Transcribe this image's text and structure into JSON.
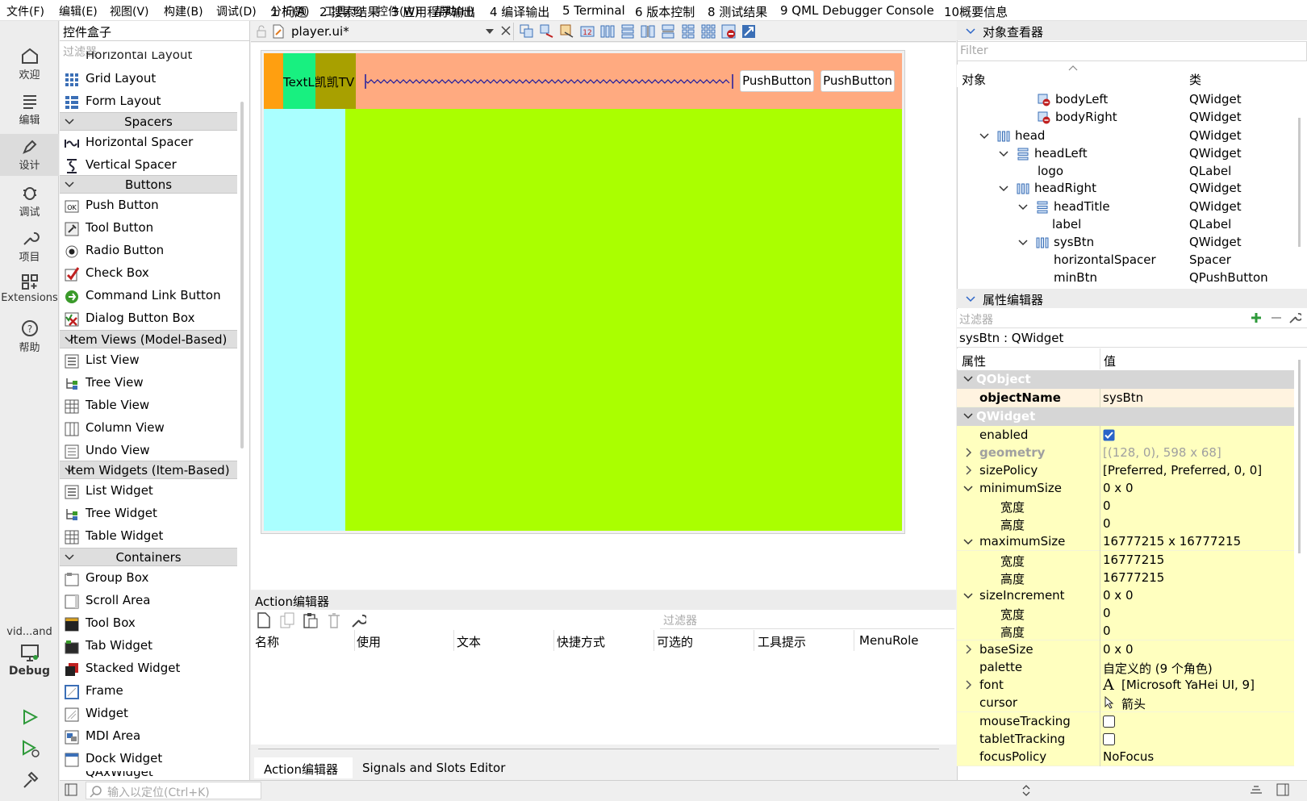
{
  "menu": [
    "文件(F)",
    "编辑(E)",
    "视图(V)",
    "构建(B)",
    "调试(D)",
    "分析(A)",
    "工具(T)",
    "控件(W)",
    "帮助(H)"
  ],
  "modes": [
    {
      "label": "欢迎",
      "icon": "home-icon"
    },
    {
      "label": "编辑",
      "icon": "edit-lines-icon"
    },
    {
      "label": "设计",
      "icon": "pen-icon"
    },
    {
      "label": "调试",
      "icon": "bug-icon"
    },
    {
      "label": "项目",
      "icon": "wrench-icon"
    },
    {
      "label": "Extensions",
      "icon": "extensions-icon"
    },
    {
      "label": "帮助",
      "icon": "help-icon"
    }
  ],
  "kit": {
    "name": "vid...and",
    "build": "Debug"
  },
  "widget_box": {
    "title": "控件盒子",
    "filter_placeholder": "过滤器",
    "clipped_item": "Horizontal Layout",
    "items_layouts": [
      "Grid Layout",
      "Form Layout"
    ],
    "cat_spacers": "Spacers",
    "items_spacers": [
      "Horizontal Spacer",
      "Vertical Spacer"
    ],
    "cat_buttons": "Buttons",
    "items_buttons": [
      "Push Button",
      "Tool Button",
      "Radio Button",
      "Check Box",
      "Command Link Button",
      "Dialog Button Box"
    ],
    "cat_item_views": "Item Views (Model-Based)",
    "items_item_views": [
      "List View",
      "Tree View",
      "Table View",
      "Column View",
      "Undo View"
    ],
    "cat_item_widgets": "Item Widgets (Item-Based)",
    "items_item_widgets": [
      "List Widget",
      "Tree Widget",
      "Table Widget"
    ],
    "cat_containers": "Containers",
    "items_containers": [
      "Group Box",
      "Scroll Area",
      "Tool Box",
      "Tab Widget",
      "Stacked Widget",
      "Frame",
      "Widget",
      "MDI Area",
      "Dock Widget",
      "QAxWidget"
    ]
  },
  "editor": {
    "file": "player.ui*",
    "form": {
      "text_label": "TextL凯凯TV",
      "btn1": "PushButton",
      "btn2": "PushButton"
    }
  },
  "action_editor": {
    "title": "Action编辑器",
    "filter_placeholder": "过滤器",
    "columns": [
      "名称",
      "使用",
      "文本",
      "快捷方式",
      "可选的",
      "工具提示",
      "MenuRole"
    ],
    "tabs": [
      "Action编辑器",
      "Signals and Slots Editor"
    ]
  },
  "object_inspector": {
    "title": "对象查看器",
    "filter_placeholder": "Filter",
    "col_object": "对象",
    "col_class": "类",
    "rows": [
      {
        "name": "bodyLeft",
        "cls": "QWidget"
      },
      {
        "name": "bodyRight",
        "cls": "QWidget"
      },
      {
        "name": "head",
        "cls": "QWidget"
      },
      {
        "name": "headLeft",
        "cls": "QWidget"
      },
      {
        "name": "logo",
        "cls": "QLabel"
      },
      {
        "name": "headRight",
        "cls": "QWidget"
      },
      {
        "name": "headTitle",
        "cls": "QWidget"
      },
      {
        "name": "label",
        "cls": "QLabel"
      },
      {
        "name": "sysBtn",
        "cls": "QWidget"
      },
      {
        "name": "horizontalSpacer",
        "cls": "Spacer"
      },
      {
        "name": "minBtn",
        "cls": "QPushButton"
      }
    ]
  },
  "property_editor": {
    "title": "属性编辑器",
    "filter_placeholder": "过滤器",
    "object_line": "sysBtn : QWidget",
    "col_prop": "属性",
    "col_value": "值",
    "group_qobject": "QObject",
    "group_qwidget": "QWidget",
    "rows": [
      {
        "name": "objectName",
        "value": "sysBtn"
      },
      {
        "name": "enabled",
        "value": ""
      },
      {
        "name": "geometry",
        "value": "[(128, 0), 598 x 68]"
      },
      {
        "name": "sizePolicy",
        "value": "[Preferred, Preferred, 0, 0]"
      },
      {
        "name": "minimumSize",
        "value": "0 x 0"
      },
      {
        "name": "宽度",
        "value": "0"
      },
      {
        "name": "高度",
        "value": "0"
      },
      {
        "name": "maximumSize",
        "value": "16777215 x 16777215"
      },
      {
        "name": "宽度",
        "value": "16777215"
      },
      {
        "name": "高度",
        "value": "16777215"
      },
      {
        "name": "sizeIncrement",
        "value": "0 x 0"
      },
      {
        "name": "宽度",
        "value": "0"
      },
      {
        "name": "高度",
        "value": "0"
      },
      {
        "name": "baseSize",
        "value": "0 x 0"
      },
      {
        "name": "palette",
        "value": "自定义的 (9 个角色)"
      },
      {
        "name": "font",
        "value": "[Microsoft YaHei UI, 9]"
      },
      {
        "name": "cursor",
        "value": "箭头"
      },
      {
        "name": "mouseTracking",
        "value": ""
      },
      {
        "name": "tabletTracking",
        "value": ""
      },
      {
        "name": "focusPolicy",
        "value": "NoFocus"
      }
    ]
  },
  "statusbar": {
    "locator_placeholder": "输入以定位(Ctrl+K)",
    "panes": [
      "1 问题",
      "2 搜索结果",
      "3 应用程序输出",
      "4 编译输出",
      "5 Terminal",
      "6 版本控制",
      "8 测试结果",
      "9 QML Debugger Console",
      "10概要信息"
    ]
  },
  "colors": {
    "accent": "#2a64c8",
    "prop_yellow": "#ffffbf",
    "prop_orange": "#fff3e0",
    "group_header": "#d6d6d6"
  }
}
